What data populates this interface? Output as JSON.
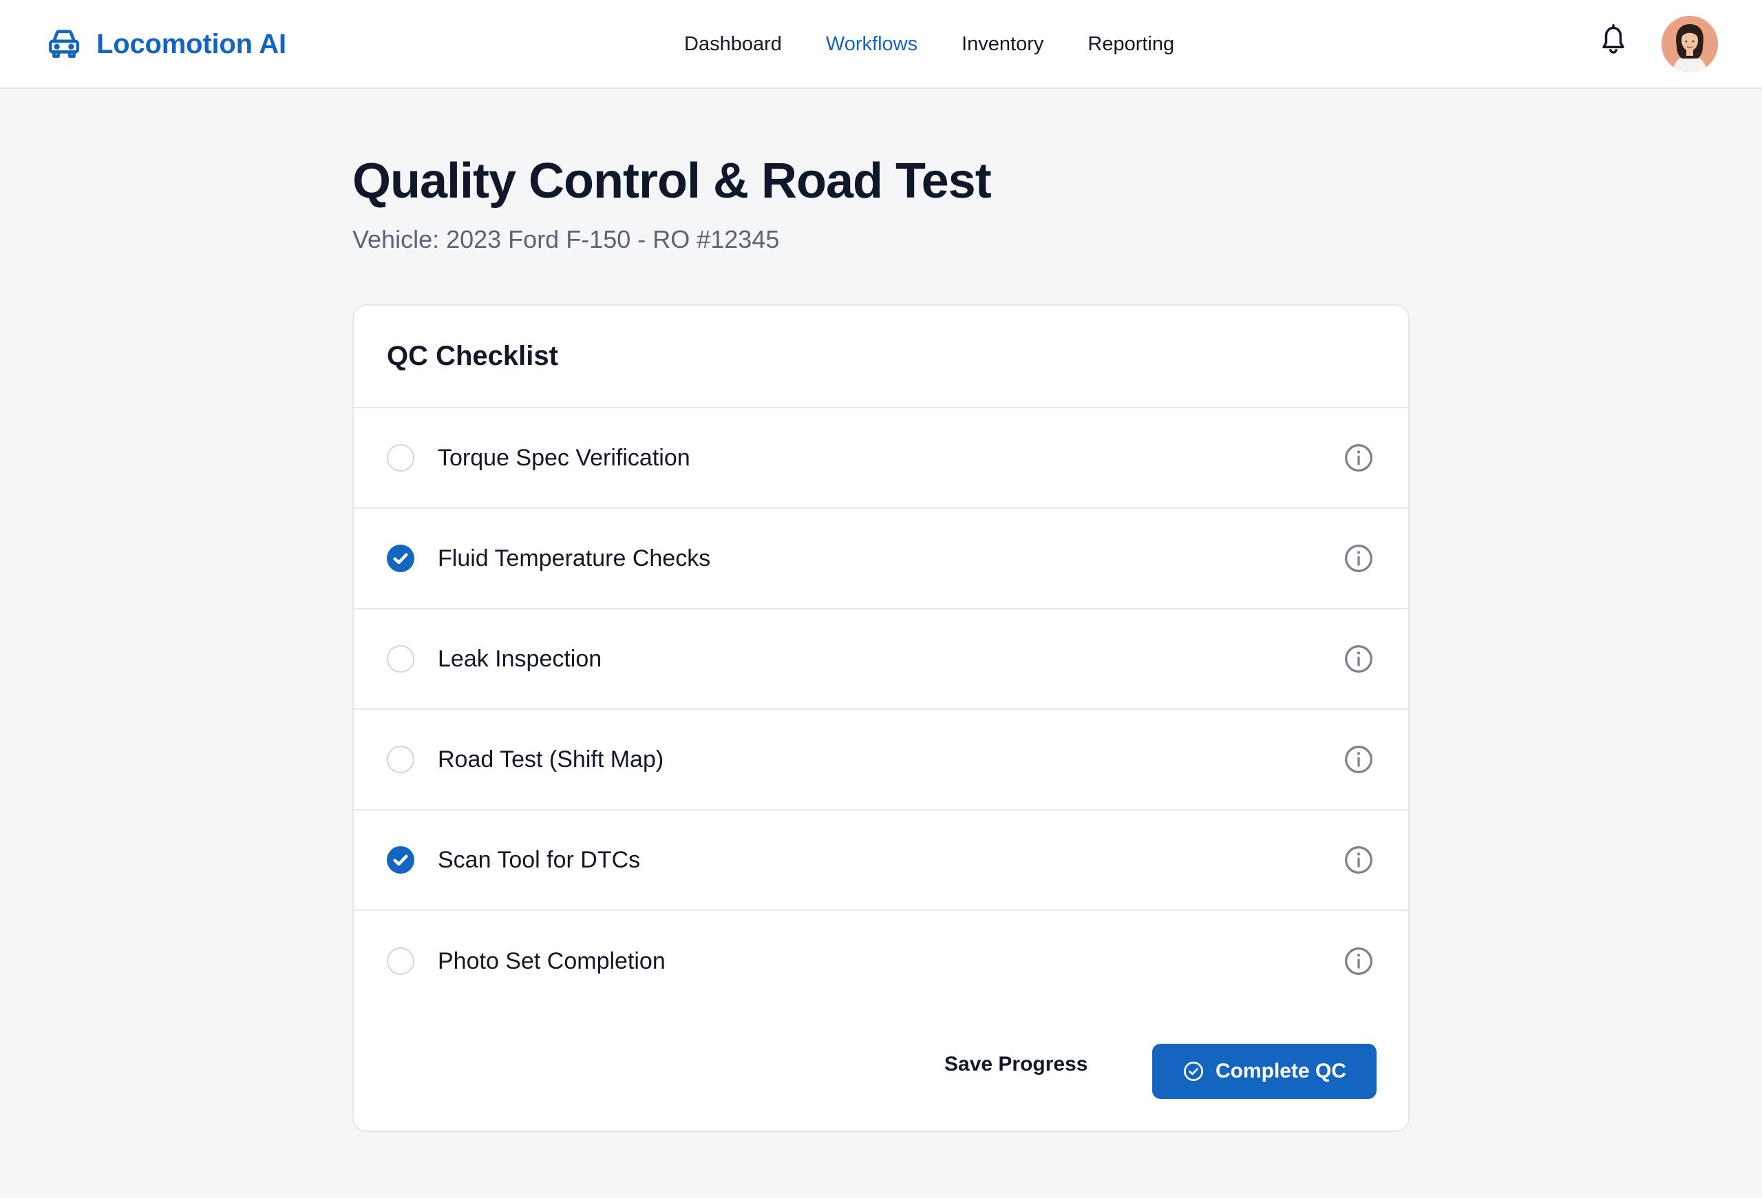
{
  "header": {
    "brand": "Locomotion AI",
    "brand_icon": "car-icon",
    "nav": [
      {
        "label": "Dashboard",
        "active": false
      },
      {
        "label": "Workflows",
        "active": true
      },
      {
        "label": "Inventory",
        "active": false
      },
      {
        "label": "Reporting",
        "active": false
      }
    ],
    "notification_icon": "bell-icon",
    "avatar_icon": "user-avatar"
  },
  "page": {
    "title": "Quality Control & Road Test",
    "subtitle": "Vehicle: 2023 Ford F-150 - RO #12345"
  },
  "checklist": {
    "title": "QC Checklist",
    "items": [
      {
        "label": "Torque Spec Verification",
        "checked": false
      },
      {
        "label": "Fluid Temperature Checks",
        "checked": true
      },
      {
        "label": "Leak Inspection",
        "checked": false
      },
      {
        "label": "Road Test (Shift Map)",
        "checked": false
      },
      {
        "label": "Scan Tool for DTCs",
        "checked": true
      },
      {
        "label": "Photo Set Completion",
        "checked": false
      }
    ],
    "info_icon": "info-icon"
  },
  "actions": {
    "save_label": "Save Progress",
    "complete_label": "Complete QC",
    "complete_icon": "check-circle-icon"
  },
  "colors": {
    "accent": "#1465c0",
    "background": "#f5f6f8",
    "border": "#e5e7eb"
  }
}
